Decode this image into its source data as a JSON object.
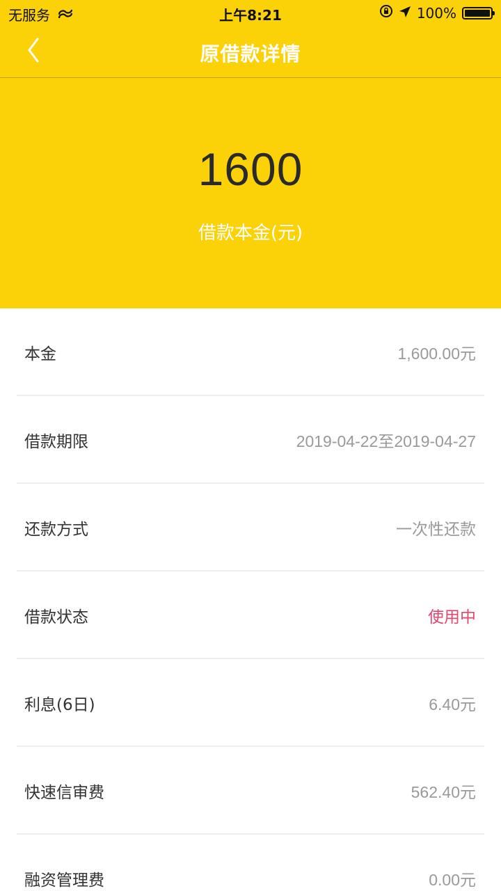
{
  "status_bar": {
    "carrier": "无服务",
    "time": "上午8:21",
    "battery": "100%"
  },
  "nav": {
    "title": "原借款详情"
  },
  "hero": {
    "amount": "1600",
    "label": "借款本金(元)"
  },
  "details": [
    {
      "label": "本金",
      "value": "1,600.00元"
    },
    {
      "label": "借款期限",
      "value": "2019-04-22至2019-04-27"
    },
    {
      "label": "还款方式",
      "value": "一次性还款"
    },
    {
      "label": "借款状态",
      "value": "使用中"
    },
    {
      "label": "利息(6日)",
      "value": "6.40元"
    },
    {
      "label": "快速信审费",
      "value": "562.40元"
    },
    {
      "label": "融资管理费",
      "value": "0.00元"
    }
  ],
  "colors": {
    "brand_yellow": "#FBD108",
    "status_active": "#E8456B",
    "value_gray": "#9A9A9A"
  }
}
